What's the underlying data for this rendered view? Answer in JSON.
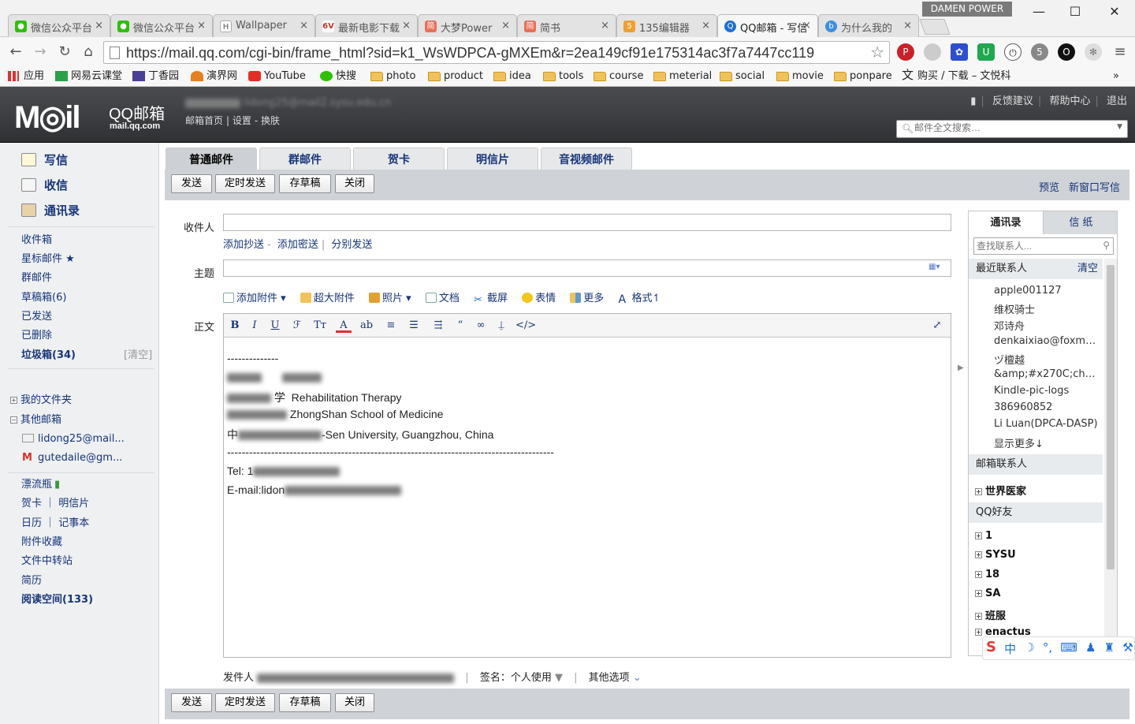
{
  "browser": {
    "user_badge": "DAMEN POWER",
    "tabs": [
      {
        "title": "微信公众平台",
        "icon": "wechat-icon",
        "color": "#2dc100",
        "active": false
      },
      {
        "title": "微信公众平台",
        "icon": "wechat-icon",
        "color": "#2dc100",
        "active": false
      },
      {
        "title": "Wallpaper",
        "icon": "wallpaper-icon",
        "color": "#777777",
        "active": false
      },
      {
        "title": "最新电影下载",
        "icon": "6v-icon",
        "color": "#c0392b",
        "active": false
      },
      {
        "title": "大梦Power",
        "icon": "jianshu-icon",
        "color": "#ea6f5a",
        "active": false
      },
      {
        "title": "简书",
        "icon": "jianshu-icon",
        "color": "#ea6f5a",
        "active": false
      },
      {
        "title": "135编辑器",
        "icon": "135-icon",
        "color": "#f0a030",
        "active": false
      },
      {
        "title": "QQ邮箱 - 写信",
        "icon": "qqmail-icon",
        "color": "#1d6fd8",
        "active": true
      },
      {
        "title": "为什么我的",
        "icon": "baidu-icon",
        "color": "#3a8ee6",
        "active": false
      }
    ],
    "url": "https://mail.qq.com/cgi-bin/frame_html?sid=k1_WsWDPCA-gMXEm&r=2ea149cf91e175314ac3f7a7447cc119",
    "bookmarks": [
      {
        "label": "应用",
        "icon": "apps-icon"
      },
      {
        "label": "网易云课堂",
        "icon": "netease-icon"
      },
      {
        "label": "丁香园",
        "icon": "dxy-icon"
      },
      {
        "label": "演界网",
        "icon": "yanjie-icon"
      },
      {
        "label": "YouTube",
        "icon": "youtube-icon"
      },
      {
        "label": "快搜",
        "icon": "kuaisou-icon"
      },
      {
        "label": "photo",
        "icon": "folder-icon"
      },
      {
        "label": "product",
        "icon": "folder-icon"
      },
      {
        "label": "idea",
        "icon": "folder-icon"
      },
      {
        "label": "tools",
        "icon": "folder-icon"
      },
      {
        "label": "course",
        "icon": "folder-icon"
      },
      {
        "label": "meterial",
        "icon": "folder-icon"
      },
      {
        "label": "social",
        "icon": "folder-icon"
      },
      {
        "label": "movie",
        "icon": "folder-icon"
      },
      {
        "label": "ponpare",
        "icon": "folder-icon"
      },
      {
        "label": "购买 / 下载 – 文悦科",
        "icon": "translate-icon"
      }
    ]
  },
  "mail": {
    "logo_qq": "QQ邮箱",
    "logo_domain": "mail.qq.com",
    "account_visible": "lidong25@mail2.sysu.edu.cn",
    "header_links": [
      "邮箱首页",
      "设置",
      "换肤"
    ],
    "top_links": [
      "反馈建议",
      "帮助中心",
      "退出"
    ],
    "search_placeholder": "邮件全文搜索…",
    "primary_nav": [
      {
        "label": "写信",
        "icon": "write-icon"
      },
      {
        "label": "收信",
        "icon": "inbox-icon"
      },
      {
        "label": "通讯录",
        "icon": "contacts-icon"
      }
    ],
    "folders": [
      {
        "label": "收件箱"
      },
      {
        "label": "星标邮件 ★"
      },
      {
        "label": "群邮件"
      },
      {
        "label": "草稿箱(6)"
      },
      {
        "label": "已发送"
      },
      {
        "label": "已删除"
      },
      {
        "label": "垃圾箱(34)"
      }
    ],
    "clear_label": "[清空]",
    "my_folders": "我的文件夹",
    "other_mailboxes": "其他邮箱",
    "other_accounts": [
      "lidong25@mail...",
      "gutedaile@gm..."
    ],
    "extras": [
      {
        "label": "漂流瓶"
      },
      {
        "label": "贺卡 ｜ 明信片"
      },
      {
        "label": "日历 ｜ 记事本"
      },
      {
        "label": "附件收藏"
      },
      {
        "label": "文件中转站"
      },
      {
        "label": "简历"
      },
      {
        "label": "阅读空间(133)"
      }
    ]
  },
  "compose": {
    "tabs": [
      "普通邮件",
      "群邮件",
      "贺卡",
      "明信片",
      "音视频邮件"
    ],
    "actions": [
      "发送",
      "定时发送",
      "存草稿",
      "关闭"
    ],
    "right_actions": [
      "预览",
      "新窗口写信"
    ],
    "to_label": "收件人",
    "to_value": "",
    "cc_links": [
      "添加抄送",
      "添加密送",
      "分别发送"
    ],
    "subject_label": "主题",
    "subject_value": "",
    "attach_tools": [
      "添加附件",
      "超大附件",
      "照片",
      "文档",
      "截屏",
      "表情",
      "更多",
      "格式"
    ],
    "body_label": "正文",
    "body_lines": [
      "--------------",
      "Rehabilitation Therapy",
      "ZhongShan School of  Medicine",
      "-Sen University, Guangzhou, China",
      "-----------------------------------------------------------------------------------------",
      "Tel: 1",
      "E-mail:lidon"
    ],
    "sender_label": "发件人",
    "signature_label": "签名：个人使用",
    "other_options": "其他选项"
  },
  "contacts_panel": {
    "tabs": [
      "通讯录",
      "信 纸"
    ],
    "search_placeholder": "查找联系人...",
    "recent_title": "最近联系人",
    "clear": "清空",
    "recent": [
      "apple001127",
      "维权骑士",
      "邓诗舟",
      "denkaixiao@foxmai...",
      "ヅ檀越",
      "&amp;#x270C;cha...",
      "Kindle-pic-logs",
      "386960852",
      "Li Luan(DPCA-DASP)"
    ],
    "show_more": "显示更多↓",
    "mailbox_contacts": "邮箱联系人",
    "mailbox_groups": [
      "世界医家"
    ],
    "qq_friends": "QQ好友",
    "qq_groups": [
      "1",
      "SYSU",
      "18",
      "SA",
      "班服",
      "enactus"
    ]
  },
  "ime": {
    "label": "中"
  }
}
